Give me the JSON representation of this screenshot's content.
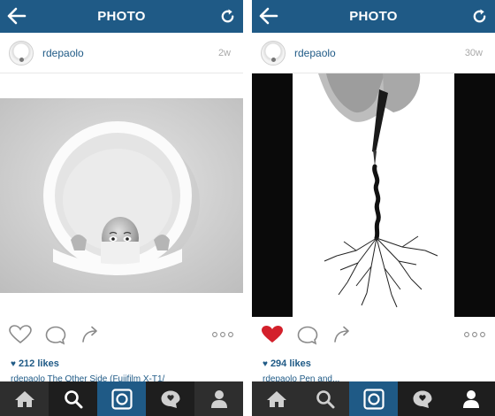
{
  "left_screen": {
    "header": {
      "title": "PHOTO",
      "back_icon": "arrow-left-icon",
      "refresh_icon": "refresh-icon"
    },
    "post": {
      "username": "rdepaolo",
      "age": "2w",
      "likes": "212 likes",
      "caption": "rdepaolo The Other Side (Fujifilm X-T1/"
    },
    "tabs": [
      {
        "name": "home",
        "icon": "home-icon"
      },
      {
        "name": "search",
        "icon": "search-icon"
      },
      {
        "name": "camera",
        "icon": "camera-icon"
      },
      {
        "name": "activity",
        "icon": "activity-bubble-icon"
      },
      {
        "name": "profile",
        "icon": "profile-icon"
      }
    ]
  },
  "right_screen": {
    "header": {
      "title": "PHOTO",
      "back_icon": "arrow-left-icon",
      "refresh_icon": "refresh-icon"
    },
    "post": {
      "username": "rdepaolo",
      "age": "30w",
      "likes": "294 likes",
      "caption": "rdepaolo Pen and..."
    },
    "tabs": [
      {
        "name": "home",
        "icon": "home-icon"
      },
      {
        "name": "search",
        "icon": "search-icon"
      },
      {
        "name": "camera",
        "icon": "camera-icon"
      },
      {
        "name": "activity",
        "icon": "activity-bubble-icon"
      },
      {
        "name": "profile",
        "icon": "profile-icon"
      }
    ]
  },
  "colors": {
    "brand_blue": "#1f5a86",
    "like_red": "#d3202b",
    "tabbar_bg": "#2e2e2e"
  }
}
